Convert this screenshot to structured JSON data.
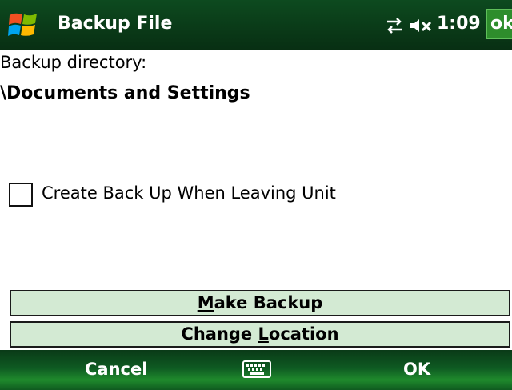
{
  "titlebar": {
    "title": "Backup File",
    "clock": "1:09",
    "ok_label": "ok"
  },
  "icons": {
    "start": "windows-flag-icon",
    "connectivity": "connectivity-arrows-icon",
    "volume": "volume-muted-icon",
    "keyboard": "keyboard-icon"
  },
  "colors": {
    "titlebar": "#0a3b18",
    "ok_button": "#2e8d2c",
    "action_button_bg": "#d3ead3",
    "softkey_bar": "#1f8a2c"
  },
  "content": {
    "directory_label": "Backup directory:",
    "directory_path": "\\Documents and Settings",
    "checkbox_label": "Create Back Up When Leaving Unit",
    "checkbox_checked": false
  },
  "buttons": {
    "make_backup": {
      "mnemonic": "M",
      "rest": "ake Backup"
    },
    "change_location": {
      "prefix": "Change ",
      "mnemonic": "L",
      "rest": "ocation"
    }
  },
  "softkeys": {
    "left": "Cancel",
    "right": "OK"
  }
}
